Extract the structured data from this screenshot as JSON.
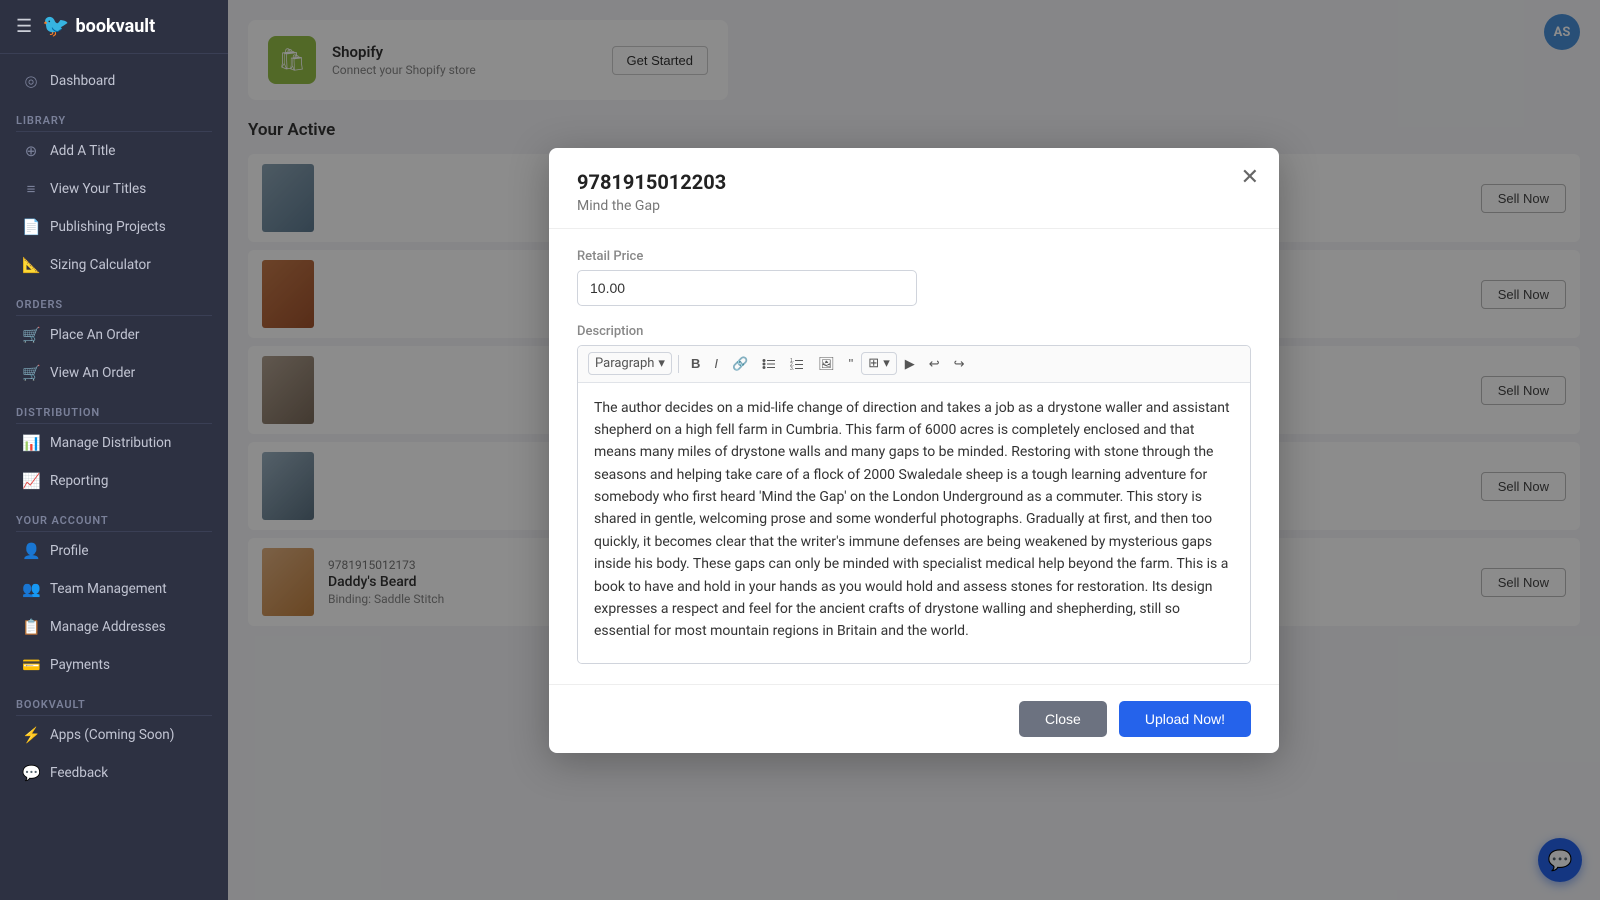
{
  "sidebar": {
    "brand": "bookvault",
    "avatar_initials": "AS",
    "menu_icon": "☰",
    "bird_icon": "🐦",
    "sections": [
      {
        "label": "",
        "items": [
          {
            "id": "dashboard",
            "label": "Dashboard",
            "icon": "◎"
          }
        ]
      },
      {
        "label": "Library",
        "items": [
          {
            "id": "add-title",
            "label": "Add A Title",
            "icon": "⊕"
          },
          {
            "id": "view-titles",
            "label": "View Your Titles",
            "icon": "☰"
          },
          {
            "id": "publishing-projects",
            "label": "Publishing Projects",
            "icon": "📄"
          },
          {
            "id": "sizing-calculator",
            "label": "Sizing Calculator",
            "icon": "📐"
          }
        ]
      },
      {
        "label": "Orders",
        "items": [
          {
            "id": "place-order",
            "label": "Place An Order",
            "icon": "🛒"
          },
          {
            "id": "view-order",
            "label": "View An Order",
            "icon": "🛒"
          }
        ]
      },
      {
        "label": "Distribution",
        "items": [
          {
            "id": "manage-distribution",
            "label": "Manage Distribution",
            "icon": "📊"
          },
          {
            "id": "reporting",
            "label": "Reporting",
            "icon": "📈"
          }
        ]
      },
      {
        "label": "Your Account",
        "items": [
          {
            "id": "profile",
            "label": "Profile",
            "icon": "👤"
          },
          {
            "id": "team-management",
            "label": "Team Management",
            "icon": "👥"
          },
          {
            "id": "manage-addresses",
            "label": "Manage Addresses",
            "icon": "📋"
          },
          {
            "id": "payments",
            "label": "Payments",
            "icon": "💳"
          }
        ]
      },
      {
        "label": "Bookvault",
        "items": [
          {
            "id": "apps",
            "label": "Apps (Coming Soon)",
            "icon": "⚡"
          },
          {
            "id": "feedback",
            "label": "Feedback",
            "icon": "💬"
          }
        ]
      }
    ]
  },
  "main": {
    "shopify": {
      "icon": "🛍",
      "title": "Shopify",
      "description": "Connect your Shopify store",
      "get_started": "Get Started"
    },
    "active_section_title": "Your Active",
    "books": [
      {
        "isbn": "",
        "title": "",
        "meta": ""
      },
      {
        "isbn": "",
        "title": "",
        "meta": ""
      },
      {
        "isbn": "",
        "title": "",
        "meta": ""
      },
      {
        "isbn": "",
        "title": "",
        "meta": ""
      },
      {
        "isbn": "9781915012173",
        "title": "Daddy's Beard",
        "meta": "Binding: Saddle Stitch"
      }
    ],
    "sell_now_label": "Sell Now"
  },
  "modal": {
    "isbn": "9781915012203",
    "subtitle": "Mind the Gap",
    "close_icon": "✕",
    "retail_price_label": "Retail Price",
    "retail_price_value": "10.00",
    "description_label": "Description",
    "description_text": "The author decides on a mid-life change of direction and takes a job as a drystone waller and assistant shepherd on a high fell farm in Cumbria. This farm of 6000 acres is completely enclosed and that means many miles of drystone walls and many gaps to be minded. Restoring with stone through the seasons and helping take care of a flock of 2000 Swaledale sheep is a tough learning adventure for somebody who first heard 'Mind the Gap' on the London Underground as a commuter. This story is shared in gentle, welcoming prose and some wonderful photographs. Gradually at first, and then too quickly, it becomes clear that the writer's immune defenses are being weakened by mysterious gaps inside his body. These gaps can only be minded with specialist medical help beyond the farm. This is a book to have and hold in your hands as you would hold and assess stones for restoration. Its design expresses a respect and feel for the ancient crafts of drystone walling and shepherding, still so essential for most mountain regions in Britain and the world.",
    "toolbar": {
      "paragraph_label": "Paragraph",
      "chevron": "▾"
    },
    "close_btn_label": "Close",
    "upload_btn_label": "Upload Now!"
  },
  "chat_bubble_icon": "💬"
}
